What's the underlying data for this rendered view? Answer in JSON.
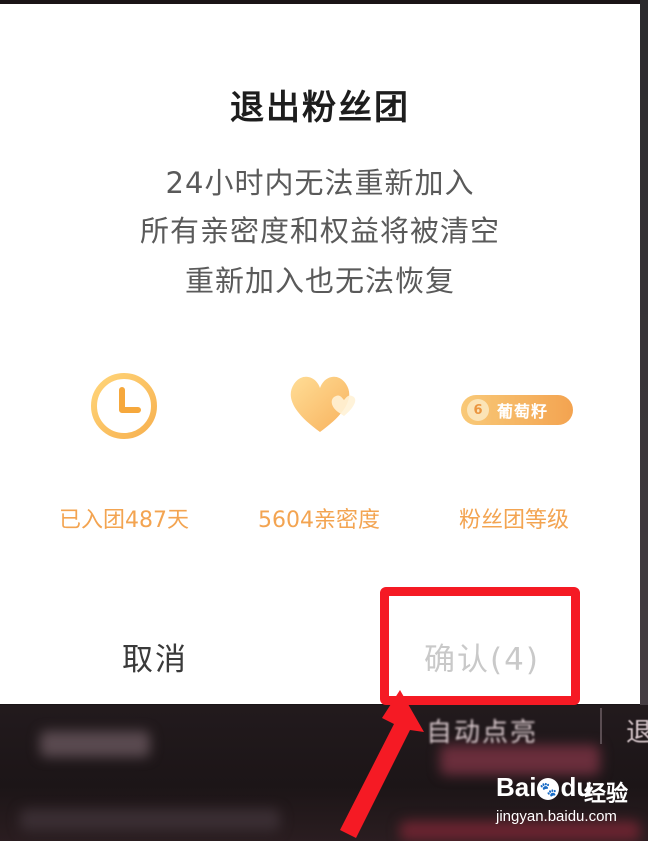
{
  "dialog": {
    "title": "退出粉丝团",
    "description_lines": [
      "24小时内无法重新加入",
      "所有亲密度和权益将被清空",
      "重新加入也无法恢复"
    ],
    "stats": [
      {
        "icon": "clock-icon",
        "label": "已入团487天"
      },
      {
        "icon": "heart-icon",
        "label": "5604亲密度"
      },
      {
        "icon": "fan-level-badge-icon",
        "badge_number": "6",
        "badge_text": "葡萄籽",
        "label": "粉丝团等级"
      }
    ],
    "cancel_label": "取消",
    "confirm_label": "确认(4)"
  },
  "background": {
    "bottom_button_label": "自动点亮",
    "right_char": "退"
  },
  "watermark": {
    "brand": "Bai",
    "brand_suffix": "du",
    "cn": "经验",
    "url": "jingyan.baidu.com"
  },
  "colors": {
    "accent_orange": "#f3a451",
    "highlight_red": "#f51a24",
    "confirm_disabled": "#c9c9c9"
  }
}
